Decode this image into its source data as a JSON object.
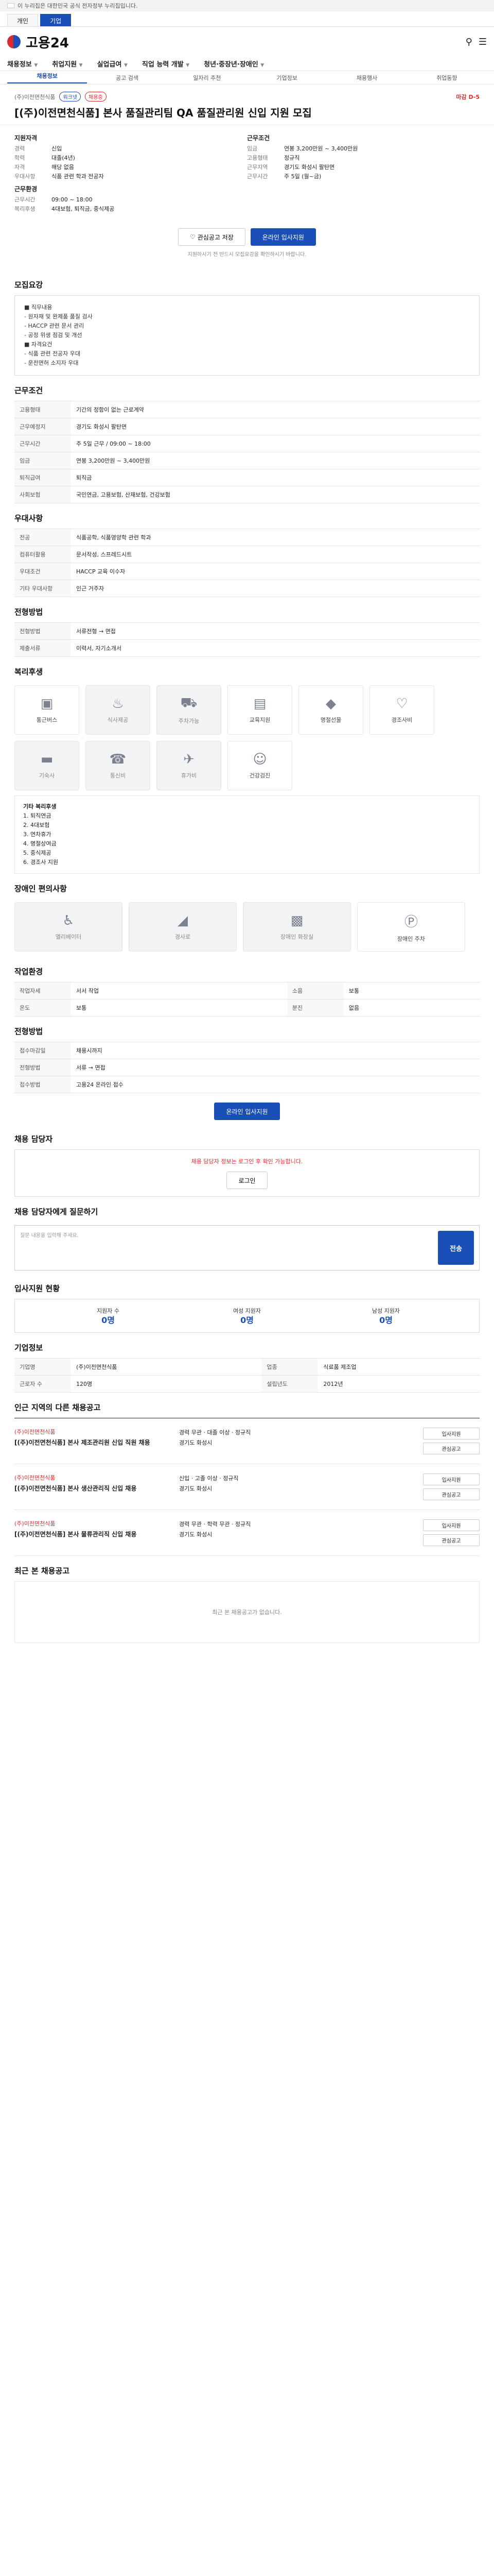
{
  "topbar": {
    "notice": "이 누리집은 대한민국 공식 전자정부 누리집입니다."
  },
  "tabs": [
    {
      "label": "개인"
    },
    {
      "label": "기업"
    }
  ],
  "header": {
    "logo": "고용24"
  },
  "nav": {
    "items": [
      "채용정보",
      "취업지원",
      "실업급여",
      "직업 능력 개발",
      "청년·중장년·장애인"
    ]
  },
  "subnav": {
    "items": [
      "채용정보",
      "공고 검색",
      "일자리 추천",
      "기업정보",
      "채용행사",
      "취업동향"
    ]
  },
  "job": {
    "company": "(주)이전면천식품",
    "badges": [
      "워크넷",
      "채용중"
    ],
    "title": "[(주)이전면천식품] 본사 품질관리팀 QA 품질관리원 신입 지원 모집",
    "dday": "마감 D-5"
  },
  "summary": {
    "left_title": "지원자격",
    "left": [
      {
        "k": "경력",
        "v": "신입"
      },
      {
        "k": "학력",
        "v": "대졸(4년)"
      },
      {
        "k": "자격",
        "v": "해당 없음"
      },
      {
        "k": "우대사항",
        "v": "식품 관련 학과 전공자"
      }
    ],
    "right_title": "근무조건",
    "right": [
      {
        "k": "임금",
        "v": "연봉 3,200만원 ~ 3,400만원"
      },
      {
        "k": "고용형태",
        "v": "정규직"
      },
      {
        "k": "근무지역",
        "v": "경기도 화성시 팔탄면"
      },
      {
        "k": "근무시간",
        "v": "주 5일 (월~금)"
      }
    ],
    "extra_title": "근무환경",
    "extra": [
      {
        "k": "근무시간",
        "v": "09:00 ~ 18:00"
      },
      {
        "k": "복리후생",
        "v": "4대보험, 퇴직금, 중식제공"
      }
    ]
  },
  "buttons": {
    "save": "관심공고 저장",
    "apply": "온라인 입사지원"
  },
  "note": "지원하시기 전 반드시 모집요강을 확인하시기 바랍니다.",
  "sections": {
    "recruit_title": "모집요강",
    "recruit_text": [
      "■ 직무내용",
      "- 원자재 및 완제품 품질 검사",
      "- HACCP 관련 문서 관리",
      "- 공정 위생 점검 및 개선",
      "■ 자격요건",
      "- 식품 관련 전공자 우대",
      "- 운전면허 소지자 우대"
    ],
    "cond_title": "근무조건",
    "cond": [
      {
        "k": "고용형태",
        "v": "기간의 정함이 없는 근로계약"
      },
      {
        "k": "근무예정지",
        "v": "경기도 화성시 팔탄면"
      },
      {
        "k": "근무시간",
        "v": "주 5일 근무 / 09:00 ~ 18:00"
      },
      {
        "k": "임금",
        "v": "연봉 3,200만원 ~ 3,400만원"
      },
      {
        "k": "퇴직급여",
        "v": "퇴직금"
      },
      {
        "k": "사회보험",
        "v": "국민연금, 고용보험, 산재보험, 건강보험"
      }
    ],
    "apply_title": "우대사항",
    "apply": [
      {
        "k": "전공",
        "v": "식품공학, 식품영양학 관련 학과"
      },
      {
        "k": "컴퓨터활용",
        "v": "문서작성, 스프레드시트"
      },
      {
        "k": "우대조건",
        "v": "HACCP 교육 이수자"
      },
      {
        "k": "기타 우대사항",
        "v": "인근 거주자"
      }
    ],
    "doc_title": "전형방법",
    "doc": [
      {
        "k": "전형방법",
        "v": "서류전형 → 면접"
      },
      {
        "k": "제출서류",
        "v": "이력서, 자기소개서"
      }
    ],
    "welfare_title": "복리후생",
    "welfare_icons": [
      {
        "icon": "building-icon",
        "label": "통근버스"
      },
      {
        "icon": "food-icon",
        "label": "식사제공"
      },
      {
        "icon": "car-icon",
        "label": "주차가능"
      },
      {
        "icon": "book-icon",
        "label": "교육지원"
      },
      {
        "icon": "gift-icon",
        "label": "명절선물"
      },
      {
        "icon": "heart-icon",
        "label": "경조사비"
      },
      {
        "icon": "bed-icon",
        "label": "기숙사"
      },
      {
        "icon": "phone-icon",
        "label": "통신비"
      },
      {
        "icon": "plane-icon",
        "label": "휴가비"
      },
      {
        "icon": "user-icon",
        "label": "건강검진"
      }
    ],
    "welfare_list": [
      "기타 복리후생",
      "1. 퇴직연금",
      "2. 4대보험",
      "3. 연차휴가",
      "4. 명절상여금",
      "5. 중식제공",
      "6. 경조사 지원"
    ],
    "disabled_title": "장애인 편의사항",
    "disabled_icons": [
      {
        "icon": "wheel-icon",
        "label": "엘리베이터"
      },
      {
        "icon": "ramp-icon",
        "label": "경사로"
      },
      {
        "icon": "toilet-icon",
        "label": "장애인 화장실"
      },
      {
        "icon": "parking-icon",
        "label": "장애인 주차"
      }
    ],
    "env_title": "작업환경",
    "env": [
      {
        "k": "작업자세",
        "v": "서서 작업"
      },
      {
        "k": "소음",
        "v": "보통"
      },
      {
        "k": "온도",
        "v": "보통"
      },
      {
        "k": "분진",
        "v": "없음"
      }
    ],
    "procedure_title": "전형방법",
    "procedure": [
      {
        "k": "접수마감일",
        "v": "채용시까지"
      },
      {
        "k": "전형방법",
        "v": "서류 → 면접"
      },
      {
        "k": "접수방법",
        "v": "고용24 온라인 접수"
      }
    ],
    "contact_title": "채용 담당자",
    "contact_notice": "채용 담당자 정보는 로그인 후 확인 가능합니다.",
    "contact_button": "로그인",
    "inquiry_title": "채용 담당자에게 질문하기",
    "inquiry_placeholder": "질문 내용을 입력해 주세요.",
    "inquiry_send": "전송",
    "stats_title": "입사지원 현황",
    "stats": [
      {
        "label": "지원자 수",
        "value": "0명"
      },
      {
        "label": "여성 지원자",
        "value": "0명"
      },
      {
        "label": "남성 지원자",
        "value": "0명"
      }
    ],
    "agency_title": "기업정보",
    "agency": [
      {
        "k": "기업명",
        "v": "(주)이전면천식품"
      },
      {
        "k": "업종",
        "v": "식료품 제조업"
      },
      {
        "k": "근로자 수",
        "v": "120명"
      },
      {
        "k": "설립년도",
        "v": "2012년"
      }
    ],
    "related_title": "인근 지역의 다른 채용공고",
    "related": [
      {
        "company": "(주)이전면천식품",
        "title": "[(주)이전면천식품] 본사 제조관리원 신입 직원 채용",
        "cond": "경력 무관 · 대졸 이상 · 정규직",
        "place": "경기도 화성시",
        "btn1": "입사지원",
        "btn2": "관심공고"
      },
      {
        "company": "(주)이전면천식품",
        "title": "[(주)이전면천식품] 본사 생산관리직 신입 채용",
        "cond": "신입 · 고졸 이상 · 정규직",
        "place": "경기도 화성시",
        "btn1": "입사지원",
        "btn2": "관심공고"
      },
      {
        "company": "(주)이전면천식품",
        "title": "[(주)이전면천식품] 본사 물류관리직 신입 채용",
        "cond": "경력 무관 · 학력 무관 · 정규직",
        "place": "경기도 화성시",
        "btn1": "입사지원",
        "btn2": "관심공고"
      }
    ],
    "recent_title": "최근 본 채용공고",
    "recent_empty": "최근 본 채용공고가 없습니다."
  }
}
